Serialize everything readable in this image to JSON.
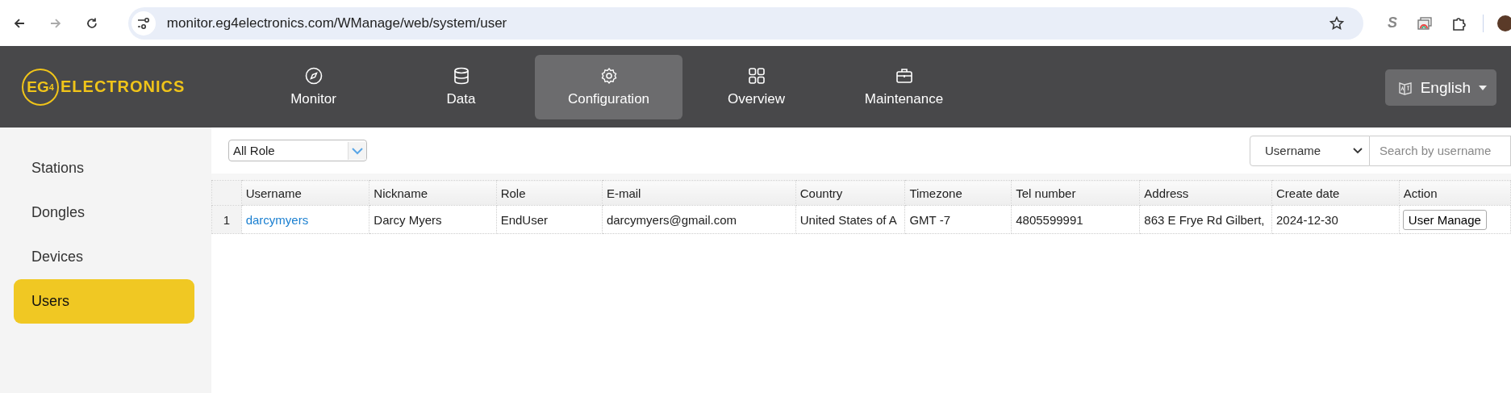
{
  "browser": {
    "url": "monitor.eg4electronics.com/WManage/web/system/user",
    "forward_disabled": true,
    "extension_letter": "S"
  },
  "header": {
    "logo": {
      "mark": "EG",
      "mark_sub": "4",
      "word": "ELECTRONICS"
    },
    "nav": [
      {
        "label": "Monitor",
        "selected": false
      },
      {
        "label": "Data",
        "selected": false
      },
      {
        "label": "Configuration",
        "selected": true
      },
      {
        "label": "Overview",
        "selected": false
      },
      {
        "label": "Maintenance",
        "selected": false
      }
    ],
    "language": "English"
  },
  "sidebar": {
    "items": [
      {
        "label": "Stations",
        "selected": false
      },
      {
        "label": "Dongles",
        "selected": false
      },
      {
        "label": "Devices",
        "selected": false
      },
      {
        "label": "Users",
        "selected": true
      }
    ]
  },
  "toolbar": {
    "role_filter": "All Role",
    "search_field": "Username",
    "search_placeholder": "Search by username"
  },
  "table": {
    "columns": [
      "Username",
      "Nickname",
      "Role",
      "E-mail",
      "Country",
      "Timezone",
      "Tel number",
      "Address",
      "Create date",
      "Action"
    ],
    "rows": [
      {
        "index": "1",
        "username": "darcymyers",
        "nickname": "Darcy Myers",
        "role": "EndUser",
        "email": "darcymyers@gmail.com",
        "country": "United States of A",
        "timezone": "GMT -7",
        "tel": "4805599991",
        "address": "863 E Frye Rd Gilbert,",
        "created": "2024-12-30",
        "action": "User Manage"
      }
    ]
  }
}
